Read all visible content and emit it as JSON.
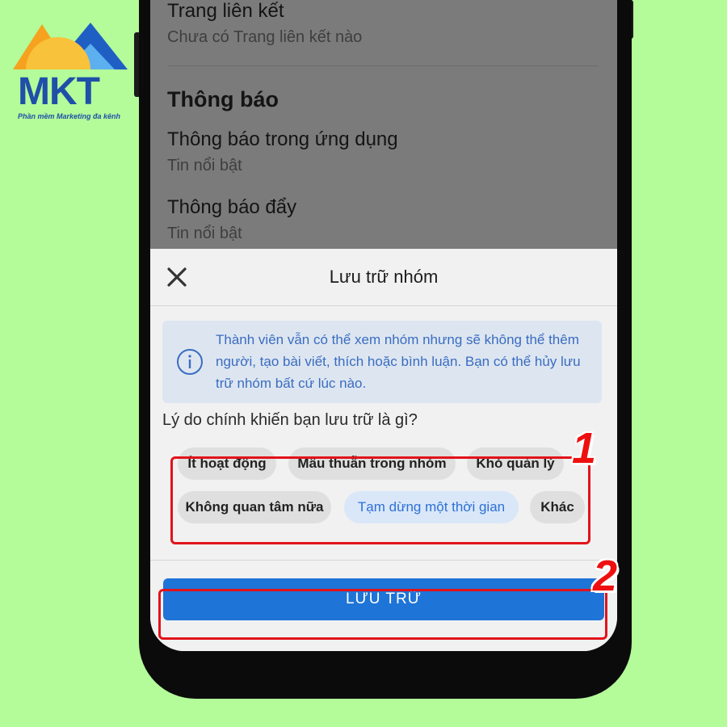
{
  "logo": {
    "text": "MKT",
    "tagline": "Phần mềm Marketing đa kênh"
  },
  "background_page": {
    "linked_pages": {
      "title": "Trang liên kết",
      "subtitle": "Chưa có Trang liên kết nào"
    },
    "notifications_heading": "Thông báo",
    "in_app": {
      "title": "Thông báo trong ứng dụng",
      "subtitle": "Tin nổi bật"
    },
    "push": {
      "title": "Thông báo đẩy",
      "subtitle": "Tin nổi bật"
    }
  },
  "sheet": {
    "title": "Lưu trữ nhóm",
    "info": "Thành viên vẫn có thể xem nhóm nhưng sẽ không thể thêm người, tạo bài viết, thích hoặc bình luận. Bạn có thể hủy lưu trữ nhóm bất cứ lúc nào.",
    "question": "Lý do chính khiến bạn lưu trữ là gì?",
    "options": [
      "Ít hoạt động",
      "Mâu thuẫn trong nhóm",
      "Khó quản lý",
      "Không quan tâm nữa",
      "Tạm dừng một thời gian",
      "Khác"
    ],
    "selected_option": "Tạm dừng một thời gian",
    "save_label": "LƯU TRỮ"
  },
  "annotations": {
    "step1": "1",
    "step2": "2",
    "color": "#e2131b"
  },
  "colors": {
    "background": "#b4fb9a",
    "primary": "#1f74d7",
    "info_text": "#3a6cc2"
  }
}
